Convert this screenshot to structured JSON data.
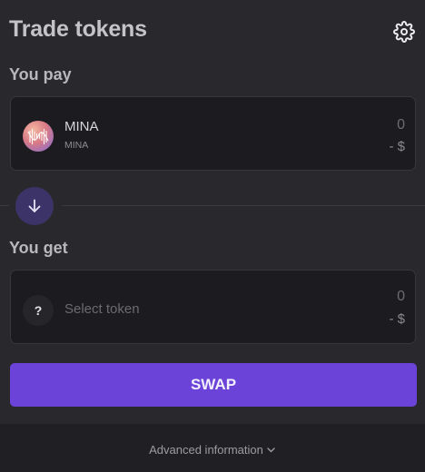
{
  "header": {
    "title": "Trade tokens",
    "settings_icon": "gear-icon"
  },
  "pay": {
    "label": "You pay",
    "token_symbol": "MINA",
    "token_name": "MINA",
    "amount": "0",
    "usd_value": "- $"
  },
  "switch": {
    "icon": "arrow-down-icon"
  },
  "get": {
    "label": "You get",
    "token_icon_glyph": "?",
    "select_label": "Select token",
    "amount": "0",
    "usd_value": "- $"
  },
  "actions": {
    "swap_label": "SWAP"
  },
  "footer": {
    "advanced_label": "Advanced information",
    "chevron_icon": "chevron-down-icon"
  },
  "colors": {
    "accent": "#6c43d9",
    "background": "#202024",
    "card": "#29292d",
    "input_box": "#1c1c20"
  }
}
